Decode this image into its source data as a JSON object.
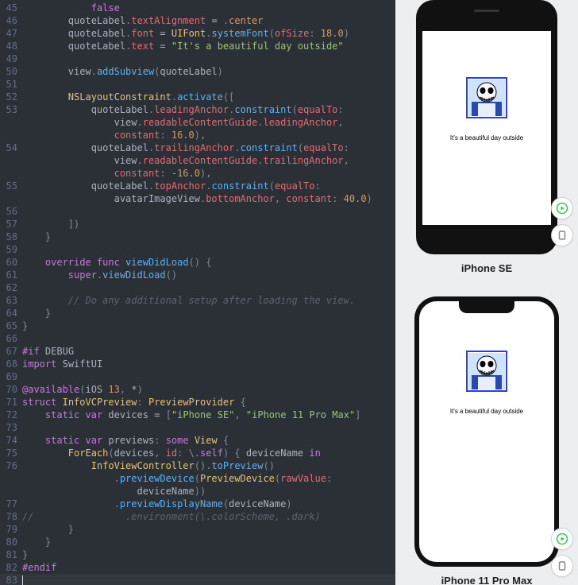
{
  "editor": {
    "lines": [
      {
        "n": 45,
        "html": "            <span class='kw'>false</span>"
      },
      {
        "n": 46,
        "html": "        <span class='id'>quoteLabel</span><span class='pn'>.</span><span class='prop'>textAlignment</span> <span class='op'>=</span> <span class='pn'>.</span><span class='en'>center</span>"
      },
      {
        "n": 47,
        "html": "        <span class='id'>quoteLabel</span><span class='pn'>.</span><span class='prop'>font</span> <span class='op'>=</span> <span class='type'>UIFont</span><span class='pn'>.</span><span class='fn'>systemFont</span><span class='pn'>(</span><span class='arg'>ofSize</span><span class='pn'>:</span> <span class='num'>18.0</span><span class='pn'>)</span>"
      },
      {
        "n": 48,
        "html": "        <span class='id'>quoteLabel</span><span class='pn'>.</span><span class='prop'>text</span> <span class='op'>=</span> <span class='str'>\"It's a beautiful day outside\"</span>"
      },
      {
        "n": 49,
        "html": ""
      },
      {
        "n": 50,
        "html": "        <span class='id'>view</span><span class='pn'>.</span><span class='fn'>addSubview</span><span class='pn'>(</span><span class='id'>quoteLabel</span><span class='pn'>)</span>"
      },
      {
        "n": 51,
        "html": ""
      },
      {
        "n": 52,
        "html": "        <span class='type'>NSLayoutConstraint</span><span class='pn'>.</span><span class='fn'>activate</span><span class='pn'>([</span>"
      },
      {
        "n": 53,
        "html": "            <span class='id'>quoteLabel</span><span class='pn'>.</span><span class='prop'>leadingAnchor</span><span class='pn'>.</span><span class='fn'>constraint</span><span class='pn'>(</span><span class='arg'>equalTo</span><span class='pn'>:</span>"
      },
      {
        "n": 0,
        "html": "                <span class='id'>view</span><span class='pn'>.</span><span class='prop'>readableContentGuide</span><span class='pn'>.</span><span class='prop'>leadingAnchor</span><span class='pn'>,</span>"
      },
      {
        "n": 0,
        "html": "                <span class='arg'>constant</span><span class='pn'>:</span> <span class='num'>16.0</span><span class='pn'>),</span>"
      },
      {
        "n": 54,
        "html": "            <span class='id'>quoteLabel</span><span class='pn'>.</span><span class='prop'>trailingAnchor</span><span class='pn'>.</span><span class='fn'>constraint</span><span class='pn'>(</span><span class='arg'>equalTo</span><span class='pn'>:</span>"
      },
      {
        "n": 0,
        "html": "                <span class='id'>view</span><span class='pn'>.</span><span class='prop'>readableContentGuide</span><span class='pn'>.</span><span class='prop'>trailingAnchor</span><span class='pn'>,</span>"
      },
      {
        "n": 0,
        "html": "                <span class='arg'>constant</span><span class='pn'>:</span> <span class='num'>-16.0</span><span class='pn'>),</span>"
      },
      {
        "n": 55,
        "html": "            <span class='id'>quoteLabel</span><span class='pn'>.</span><span class='prop'>topAnchor</span><span class='pn'>.</span><span class='fn'>constraint</span><span class='pn'>(</span><span class='arg'>equalTo</span><span class='pn'>:</span>"
      },
      {
        "n": 0,
        "html": "                <span class='id'>avatarImageView</span><span class='pn'>.</span><span class='prop'>bottomAnchor</span><span class='pn'>,</span> <span class='arg'>constant</span><span class='pn'>:</span> <span class='num'>40.0</span><span class='pn'>)</span>"
      },
      {
        "n": 56,
        "html": ""
      },
      {
        "n": 57,
        "html": "        <span class='pn'>])</span>"
      },
      {
        "n": 58,
        "html": "    <span class='pn'>}</span>"
      },
      {
        "n": 59,
        "html": ""
      },
      {
        "n": 60,
        "html": "    <span class='kw'>override</span> <span class='kw'>func</span> <span class='fn'>viewDidLoad</span><span class='pn'>() {</span>"
      },
      {
        "n": 61,
        "html": "        <span class='kw'>super</span><span class='pn'>.</span><span class='fn'>viewDidLoad</span><span class='pn'>()</span>"
      },
      {
        "n": 62,
        "html": ""
      },
      {
        "n": 63,
        "html": "        <span class='cm'>// Do any additional setup after loading the view.</span>"
      },
      {
        "n": 64,
        "html": "    <span class='pn'>}</span>"
      },
      {
        "n": 65,
        "html": "<span class='pn'>}</span>"
      },
      {
        "n": 66,
        "html": ""
      },
      {
        "n": 67,
        "html": "<span class='dec'>#if</span> <span class='id'>DEBUG</span>"
      },
      {
        "n": 68,
        "html": "<span class='kw'>import</span> <span class='id'>SwiftUI</span>"
      },
      {
        "n": 69,
        "html": ""
      },
      {
        "n": 70,
        "html": "<span class='kw'>@available</span><span class='pn'>(</span><span class='id'>iOS</span> <span class='num'>13</span><span class='pn'>,</span> <span class='op'>*</span><span class='pn'>)</span>"
      },
      {
        "n": 71,
        "html": "<span class='kw'>struct</span> <span class='type'>InfoVCPreview</span><span class='pn'>:</span> <span class='type'>PreviewProvider</span> <span class='pn'>{</span>"
      },
      {
        "n": 72,
        "html": "    <span class='kw'>static</span> <span class='kw'>var</span> <span class='id'>devices</span> <span class='op'>=</span> <span class='pn'>[</span><span class='str'>\"iPhone SE\"</span><span class='pn'>,</span> <span class='str'>\"iPhone 11 Pro Max\"</span><span class='pn'>]</span>"
      },
      {
        "n": 73,
        "html": ""
      },
      {
        "n": 74,
        "html": "    <span class='kw'>static</span> <span class='kw'>var</span> <span class='id'>previews</span><span class='pn'>:</span> <span class='kw'>some</span> <span class='type'>View</span> <span class='pn'>{</span>"
      },
      {
        "n": 75,
        "html": "        <span class='type'>ForEach</span><span class='pn'>(</span><span class='id'>devices</span><span class='pn'>,</span> <span class='arg'>id</span><span class='pn'>:</span> <span class='pn'>\\.</span><span class='kw'>self</span><span class='pn'>) {</span> <span class='id'>deviceName</span> <span class='kw'>in</span>"
      },
      {
        "n": 76,
        "html": "            <span class='type'>InfoViewController</span><span class='pn'>().</span><span class='fn'>toPreview</span><span class='pn'>()</span>"
      },
      {
        "n": 0,
        "html": "                <span class='pn'>.</span><span class='fn'>previewDevice</span><span class='pn'>(</span><span class='type'>PreviewDevice</span><span class='pn'>(</span><span class='arg'>rawValue</span><span class='pn'>:</span>"
      },
      {
        "n": 0,
        "html": "                    <span class='id'>deviceName</span><span class='pn'>))</span>"
      },
      {
        "n": 77,
        "html": "                <span class='pn'>.</span><span class='fn'>previewDisplayName</span><span class='pn'>(</span><span class='id'>deviceName</span><span class='pn'>)</span>"
      },
      {
        "n": 78,
        "html": "<span class='cm'>//                .environment(\\.colorScheme, .dark)</span>"
      },
      {
        "n": 79,
        "html": "        <span class='pn'>}</span>"
      },
      {
        "n": 80,
        "html": "    <span class='pn'>}</span>"
      },
      {
        "n": 81,
        "html": "<span class='pn'>}</span>"
      },
      {
        "n": 82,
        "html": "<span class='dec'>#endif</span>"
      },
      {
        "n": 83,
        "html": "",
        "cursor": true
      }
    ]
  },
  "preview": {
    "quote": "It's a beautiful day outside",
    "device1_label": "iPhone SE",
    "device2_label": "iPhone 11 Pro Max"
  }
}
